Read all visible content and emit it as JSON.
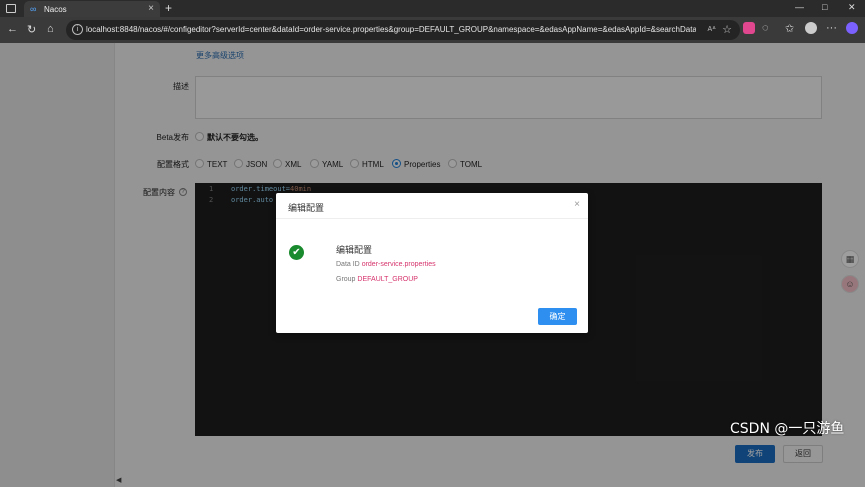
{
  "browser": {
    "tab_title": "Nacos",
    "tab_favicon": "∞",
    "url": "localhost:8848/nacos/#/configeditor?serverId=center&dataId=order-service.properties&group=DEFAULT_GROUP&namespace=&edasAppName=&edasAppId=&searchDatal...",
    "zoom": "Á̀"
  },
  "form": {
    "advanced_link": "更多高级选项",
    "description_label": "描述",
    "beta_label": "Beta发布",
    "beta_text": "默认不要勾选。",
    "format_label": "配置格式",
    "formats": [
      "TEXT",
      "JSON",
      "XML",
      "YAML",
      "HTML",
      "Properties",
      "TOML"
    ],
    "selected_format": "Properties",
    "content_label": "配置内容",
    "editor_lines": [
      {
        "n": "1",
        "key": "order.timeout",
        "eq": "=",
        "val": "40min"
      },
      {
        "n": "2",
        "key": "order.auto",
        "eq": "",
        "val": ""
      }
    ],
    "publish_button": "发布",
    "back_button": "返回"
  },
  "dialog": {
    "title": "编辑配置",
    "message_title": "编辑配置",
    "data_id_label": "Data ID",
    "data_id_value": "order-service.properties",
    "group_label": "Group",
    "group_value": "DEFAULT_GROUP",
    "ok_button": "确定"
  },
  "watermark": "CSDN @一只游鱼"
}
